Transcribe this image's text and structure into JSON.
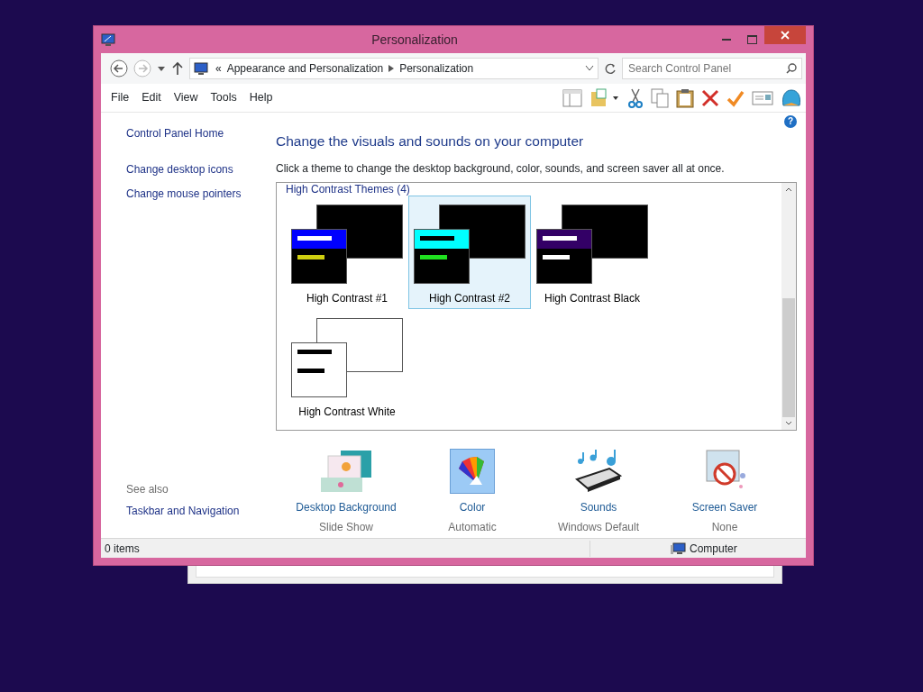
{
  "window": {
    "title": "Personalization"
  },
  "address": {
    "crumbs": [
      "«",
      "Appearance and Personalization",
      "Personalization"
    ]
  },
  "search": {
    "placeholder": "Search Control Panel"
  },
  "menu": [
    "File",
    "Edit",
    "View",
    "Tools",
    "Help"
  ],
  "sidebar": {
    "links": [
      "Control Panel Home",
      "Change desktop icons",
      "Change mouse pointers"
    ],
    "see_also_label": "See also",
    "see_also": [
      "Taskbar and Navigation"
    ]
  },
  "heading": "Change the visuals and sounds on your computer",
  "intro": "Click a theme to change the desktop background, color, sounds, and screen saver all at once.",
  "theme_group": {
    "title": "High Contrast Themes (4)"
  },
  "themes": [
    {
      "name": "High Contrast #1",
      "selected": false,
      "kind": "hc1"
    },
    {
      "name": "High Contrast #2",
      "selected": true,
      "kind": "hc2"
    },
    {
      "name": "High Contrast Black",
      "selected": false,
      "kind": "black"
    },
    {
      "name": "High Contrast White",
      "selected": false,
      "kind": "white"
    }
  ],
  "help": "?",
  "settings": [
    {
      "kind": "background",
      "label": "Desktop Background",
      "value": "Slide Show"
    },
    {
      "kind": "color",
      "label": "Color",
      "value": "Automatic"
    },
    {
      "kind": "sounds",
      "label": "Sounds",
      "value": "Windows Default"
    },
    {
      "kind": "screensaver",
      "label": "Screen Saver",
      "value": "None"
    }
  ],
  "status_bar": {
    "items": "0 items",
    "location": "Computer"
  }
}
